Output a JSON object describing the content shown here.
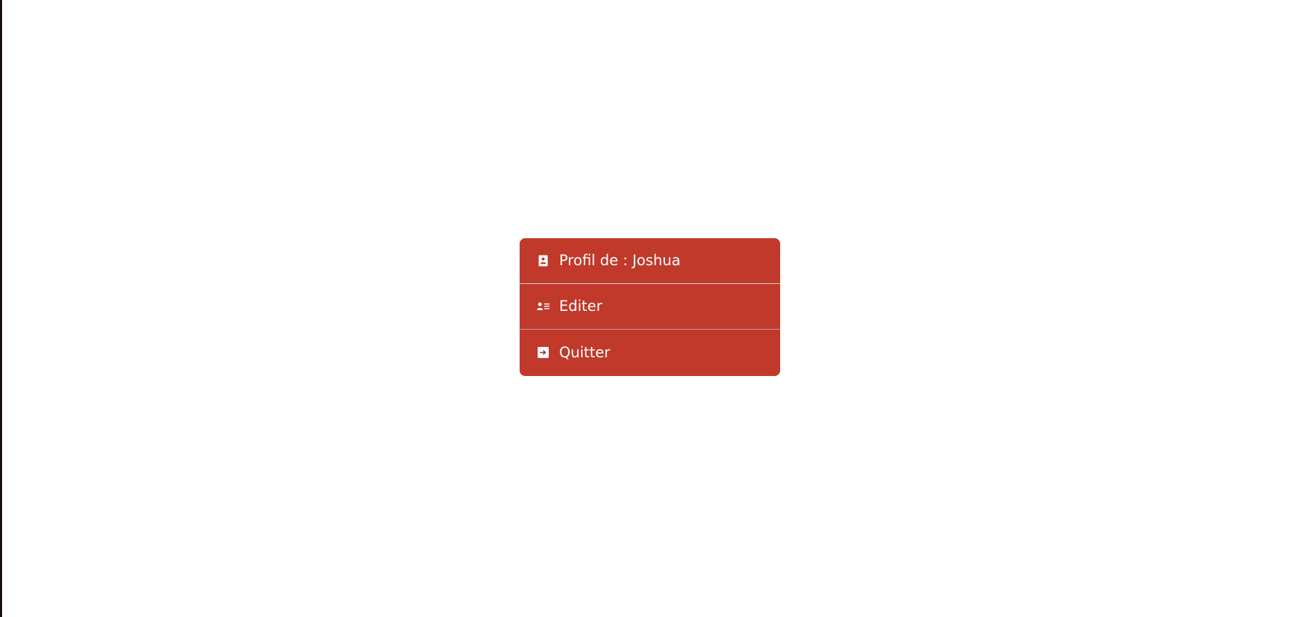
{
  "menu": {
    "background_color": "#c0392b",
    "text_color": "#ffffff",
    "items": [
      {
        "label": "Profil de : Joshua",
        "icon": "contact-card-icon"
      },
      {
        "label": "Editer",
        "icon": "user-list-icon"
      },
      {
        "label": "Quitter",
        "icon": "sign-out-icon"
      }
    ]
  }
}
